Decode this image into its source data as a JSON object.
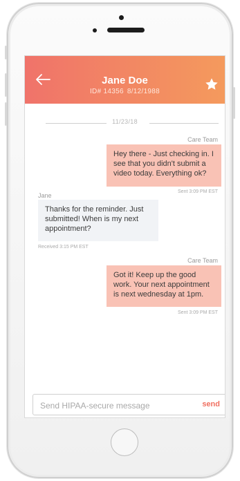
{
  "header": {
    "patient_name": "Jane Doe",
    "patient_id": "ID# 14356",
    "patient_dob": "8/12/1988",
    "back_icon": "arrow-left-icon",
    "favorite_icon": "star-icon"
  },
  "conversation": {
    "date": "11/23/18",
    "messages": [
      {
        "sender": "Care Team",
        "text": "Hey there - Just checking in. I see that you didn't submit a video today. Everything ok?",
        "timestamp": "Sent 3:09 PM EST",
        "direction": "outgoing"
      },
      {
        "sender": "Jane",
        "text": "Thanks for the reminder. Just submitted! When is my next appointment?",
        "timestamp": "Received 3:15 PM EST",
        "direction": "incoming"
      },
      {
        "sender": "Care Team",
        "text": "Got it! Keep up the good work. Your next appointment is next wednesday at 1pm.",
        "timestamp": "Sent 3:09 PM EST",
        "direction": "outgoing"
      }
    ]
  },
  "composer": {
    "placeholder": "Send HIPAA-secure message",
    "value": "",
    "send_label": "send"
  },
  "colors": {
    "header_start": "#f0736a",
    "header_end": "#f49a5d",
    "outgoing_bubble": "#f9c2b5",
    "incoming_bubble": "#f1f3f6",
    "accent": "#f07061"
  }
}
